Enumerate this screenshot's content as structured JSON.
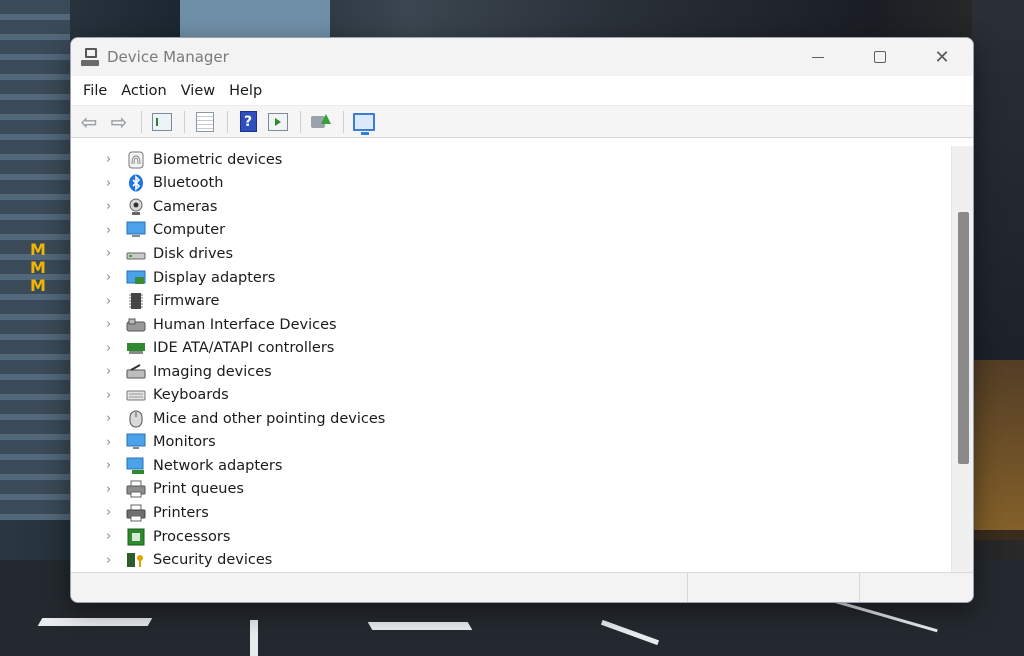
{
  "window": {
    "title": "Device Manager"
  },
  "menu": [
    "File",
    "Action",
    "View",
    "Help"
  ],
  "toolbar": {
    "buttons": [
      {
        "name": "back-arrow-icon"
      },
      {
        "name": "forward-arrow-icon"
      },
      {
        "name": "show-hide-console-tree-icon"
      },
      {
        "name": "properties-list-icon"
      },
      {
        "name": "help-icon",
        "glyph": "?"
      },
      {
        "name": "action-pane-icon"
      },
      {
        "name": "update-driver-icon"
      },
      {
        "name": "scan-hardware-icon"
      }
    ]
  },
  "devices": [
    {
      "label": "Biometric devices",
      "icon": "fingerprint-icon"
    },
    {
      "label": "Bluetooth",
      "icon": "bluetooth-icon"
    },
    {
      "label": "Cameras",
      "icon": "camera-icon"
    },
    {
      "label": "Computer",
      "icon": "computer-icon"
    },
    {
      "label": "Disk drives",
      "icon": "disk-drive-icon"
    },
    {
      "label": "Display adapters",
      "icon": "display-adapter-icon"
    },
    {
      "label": "Firmware",
      "icon": "firmware-icon"
    },
    {
      "label": "Human Interface Devices",
      "icon": "hid-icon"
    },
    {
      "label": "IDE ATA/ATAPI controllers",
      "icon": "ide-controller-icon"
    },
    {
      "label": "Imaging devices",
      "icon": "imaging-device-icon"
    },
    {
      "label": "Keyboards",
      "icon": "keyboard-icon"
    },
    {
      "label": "Mice and other pointing devices",
      "icon": "mouse-icon"
    },
    {
      "label": "Monitors",
      "icon": "monitor-icon"
    },
    {
      "label": "Network adapters",
      "icon": "network-adapter-icon"
    },
    {
      "label": "Print queues",
      "icon": "print-queue-icon"
    },
    {
      "label": "Printers",
      "icon": "printer-icon"
    },
    {
      "label": "Processors",
      "icon": "processor-icon"
    },
    {
      "label": "Security devices",
      "icon": "security-device-icon"
    }
  ],
  "glyphs": {
    "chevron": "›",
    "close": "✕",
    "back": "⇦",
    "forward": "⇨",
    "bluetooth": "ᛒ"
  },
  "background": {
    "sign_letters": [
      "M",
      "M",
      "M"
    ]
  },
  "colors": {
    "window_bg": "#ffffff",
    "title_bg": "#f3f3f3",
    "accent_blue": "#1e73e8"
  }
}
